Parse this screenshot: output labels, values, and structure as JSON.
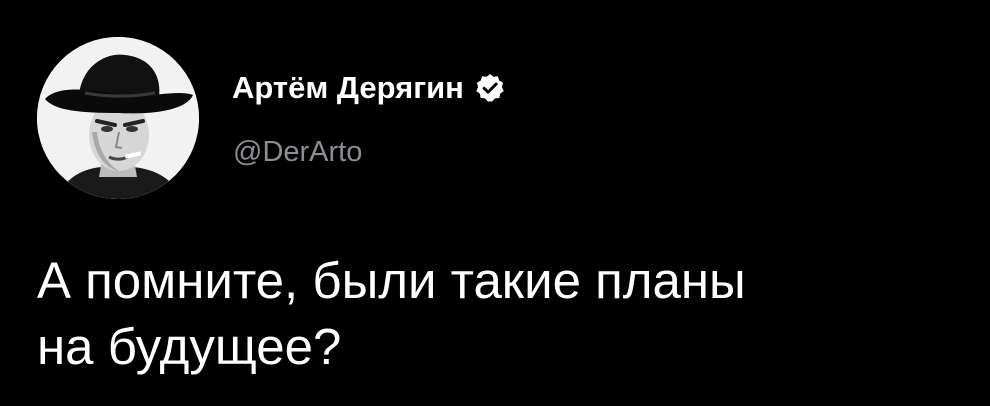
{
  "tweet": {
    "author": {
      "display_name": "Артём Дерягин",
      "handle": "@DerArto",
      "verified": true,
      "avatar_icon": "user-avatar-photo",
      "verified_icon": "verified-badge-icon"
    },
    "text": "А помните, были такие планы\nна будущее?"
  },
  "colors": {
    "background": "#000000",
    "text_primary": "#ffffff",
    "text_secondary": "#8a8d91"
  }
}
